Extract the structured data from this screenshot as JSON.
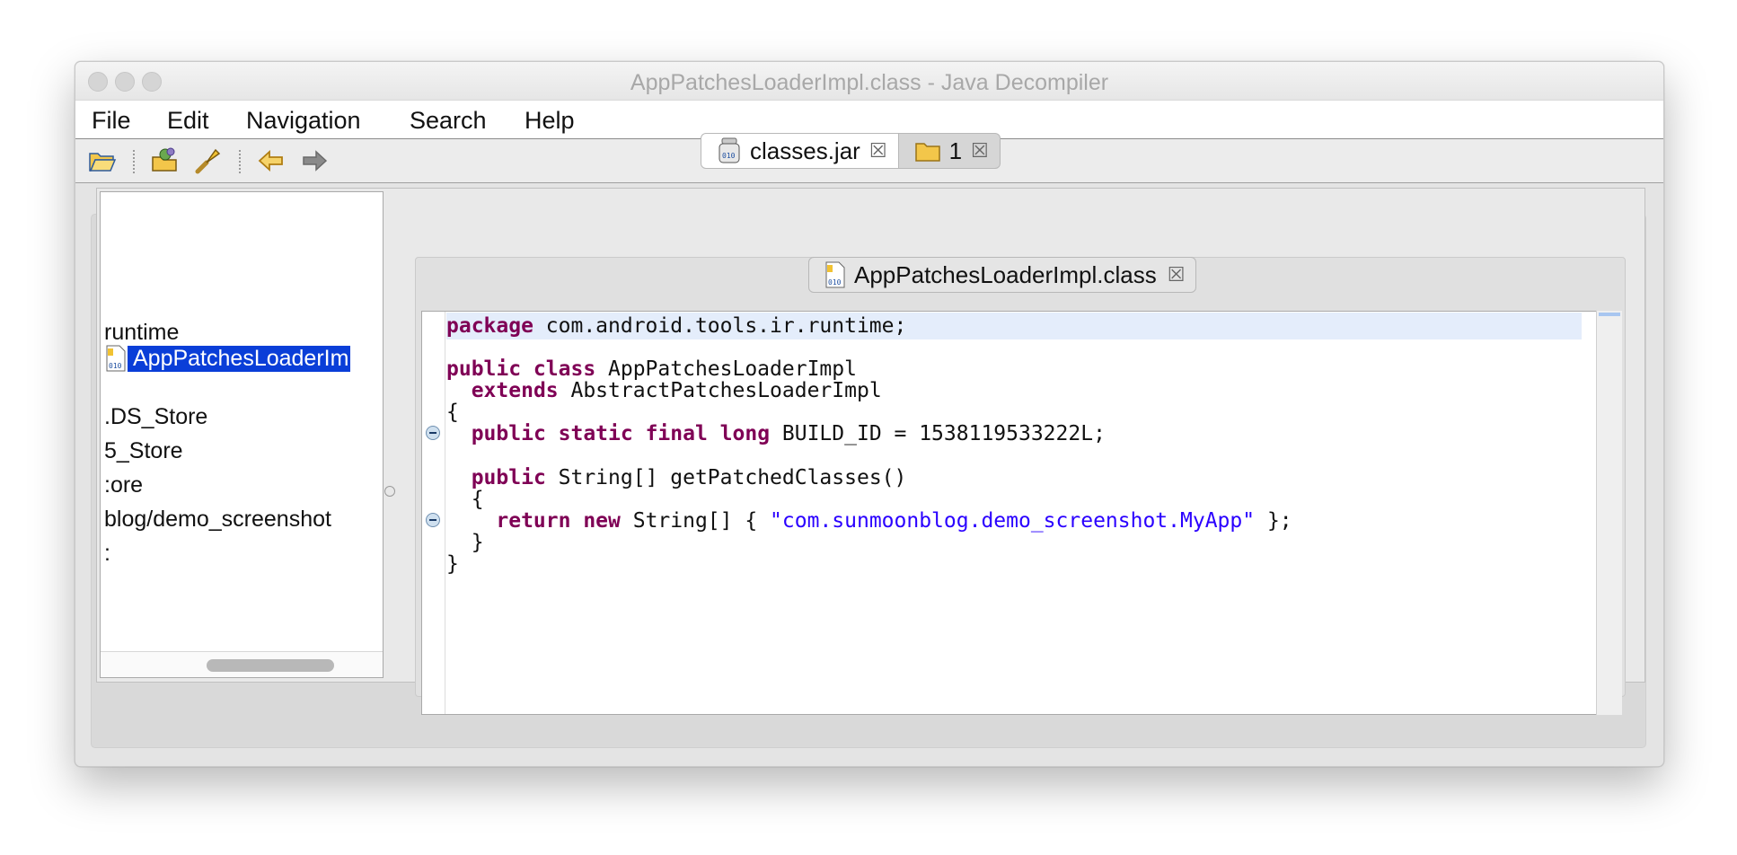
{
  "window": {
    "title": "AppPatchesLoaderImpl.class - Java Decompiler"
  },
  "menu": {
    "items": [
      "File",
      "Edit",
      "Navigation",
      "Search",
      "Help"
    ]
  },
  "toolbar": {
    "buttons": [
      "open-folder-icon",
      "open-type-icon",
      "search-icon",
      "back-arrow-icon",
      "forward-arrow-icon"
    ]
  },
  "tabs": {
    "items": [
      {
        "label": "classes.jar",
        "icon": "jar-icon",
        "active": true
      },
      {
        "label": "1",
        "icon": "folder-icon",
        "active": false
      }
    ]
  },
  "tree": {
    "rows": [
      {
        "label": "runtime",
        "selected": false
      },
      {
        "label": "AppPatchesLoaderIm",
        "selected": true,
        "icon": "class-file-icon"
      },
      {
        "label": ".DS_Store",
        "selected": false
      },
      {
        "label": "5_Store",
        "selected": false
      },
      {
        "label": ":ore",
        "selected": false
      },
      {
        "label": "blog/demo_screenshot",
        "selected": false
      },
      {
        "label": ":",
        "selected": false
      }
    ]
  },
  "editor": {
    "tab_label": "AppPatchesLoaderImpl.class",
    "code": {
      "l1_kw": "package",
      "l1_rest": " com.android.tools.ir.runtime;",
      "l3_kw": "public class",
      "l3_rest": " AppPatchesLoaderImpl",
      "l4_kw": "extends",
      "l4_rest": " AbstractPatchesLoaderImpl",
      "l5": "{",
      "l6_kw": "public static final long",
      "l6_rest": " BUILD_ID = 1538119533222L;",
      "l8_kw": "public",
      "l8_rest": " String[] getPatchedClasses()",
      "l9": "{",
      "l10_kw": "return new",
      "l10_mid": " String[] { ",
      "l10_str": "\"com.sunmoonblog.demo_screenshot.MyApp\"",
      "l10_end": " };",
      "l11": "}",
      "l12": "}"
    }
  }
}
